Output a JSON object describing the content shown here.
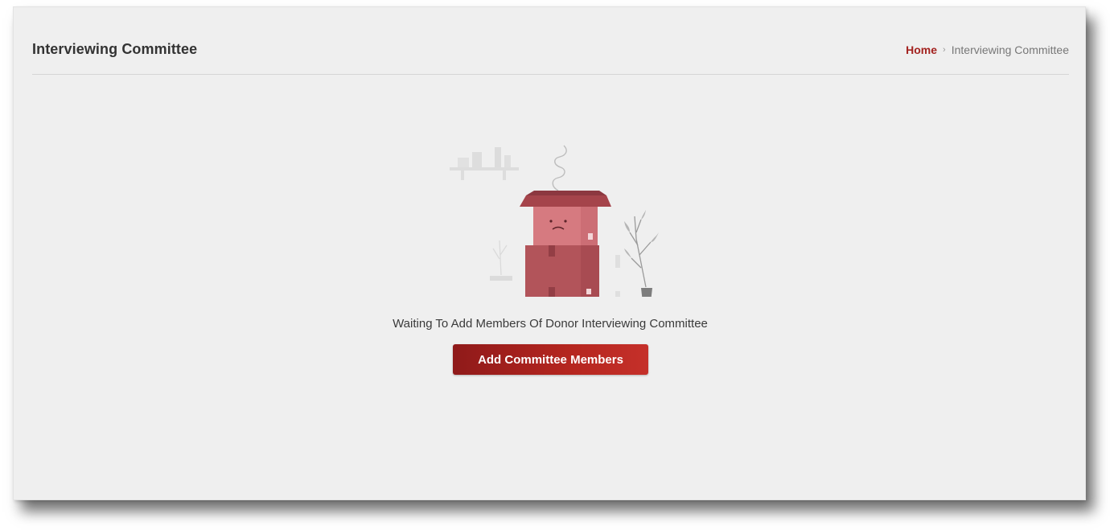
{
  "header": {
    "title": "Interviewing Committee"
  },
  "breadcrumb": {
    "home": "Home",
    "separator": "›",
    "current": "Interviewing Committee"
  },
  "empty_state": {
    "illustration": "empty-box-icon",
    "message": "Waiting To Add Members Of Donor Interviewing Committee",
    "button_label": "Add Committee Members"
  },
  "colors": {
    "accent": "#a3221f",
    "button_start": "#8f1a1a",
    "button_end": "#c5302a",
    "card_background": "#efefef",
    "box_dark": "#b2545a",
    "box_light": "#d67a80"
  }
}
